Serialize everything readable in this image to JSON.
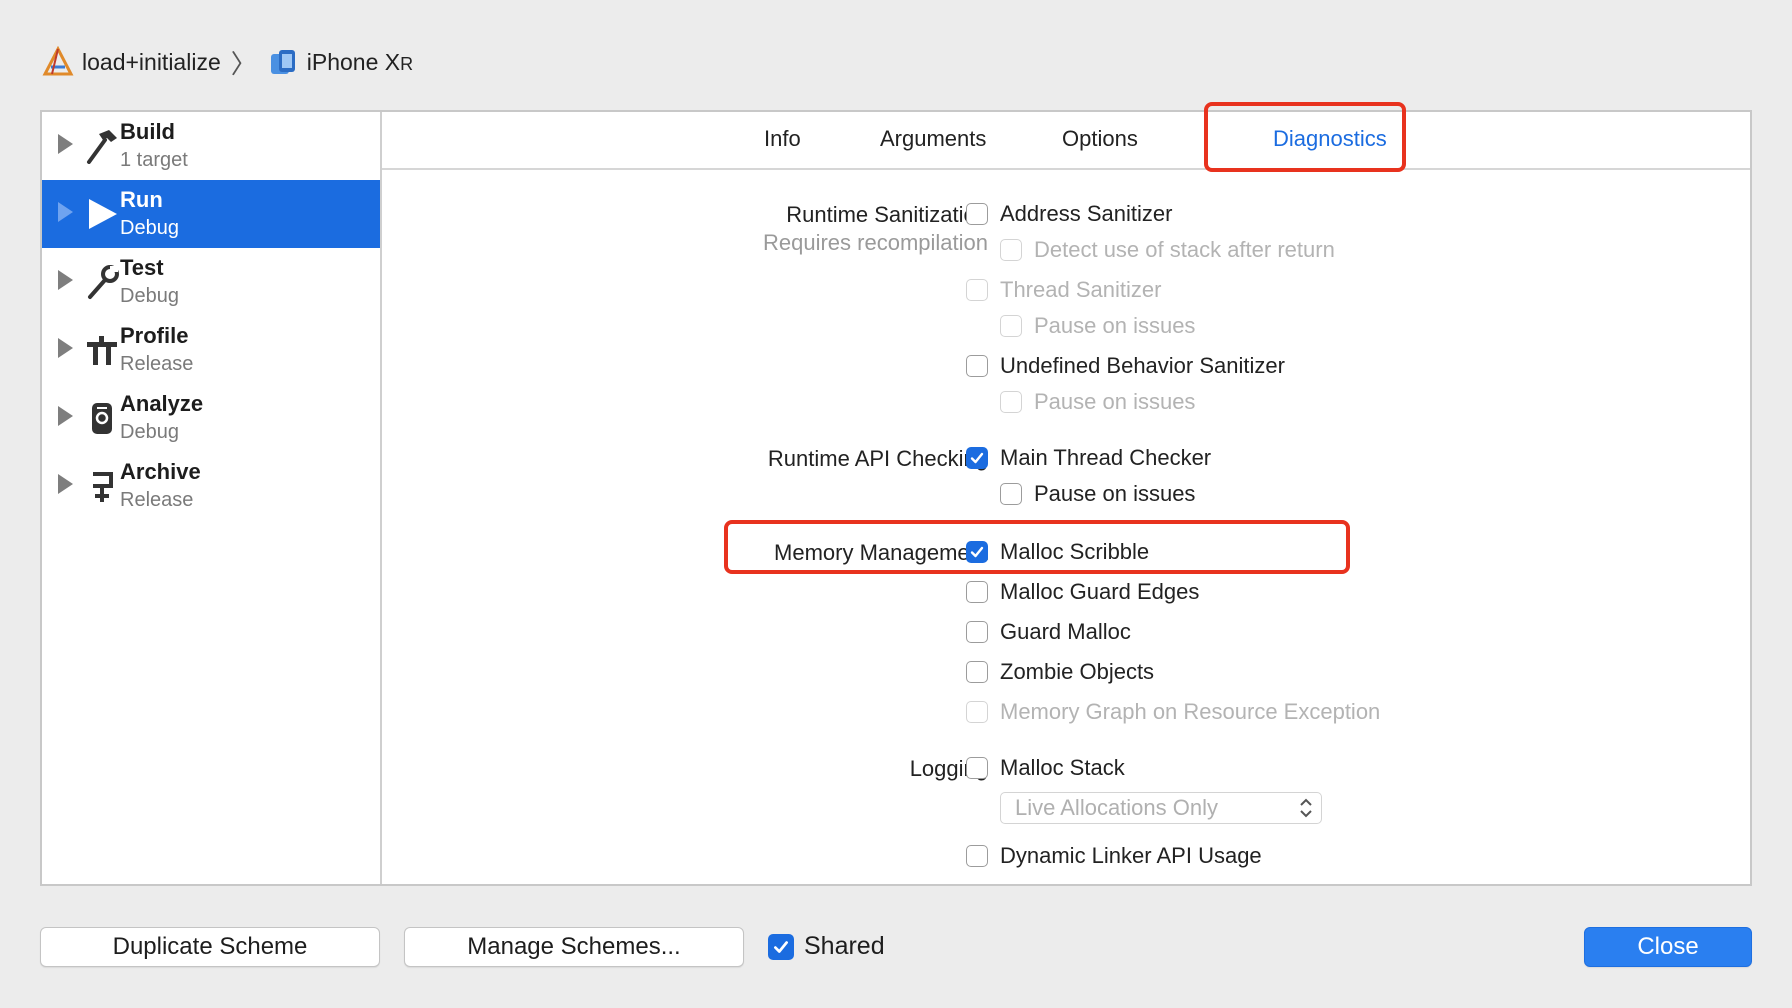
{
  "breadcrumb": {
    "project": "load+initialize",
    "device": "iPhone X",
    "device_suffix": "R"
  },
  "sidebar": {
    "actions": [
      {
        "title": "Build",
        "subtitle": "1 target",
        "icon": "hammer-icon"
      },
      {
        "title": "Run",
        "subtitle": "Debug",
        "icon": "play-icon",
        "selected": true
      },
      {
        "title": "Test",
        "subtitle": "Debug",
        "icon": "wrench-icon"
      },
      {
        "title": "Profile",
        "subtitle": "Release",
        "icon": "instruments-icon"
      },
      {
        "title": "Analyze",
        "subtitle": "Debug",
        "icon": "analyze-icon"
      },
      {
        "title": "Archive",
        "subtitle": "Release",
        "icon": "archive-icon"
      }
    ]
  },
  "tabs": {
    "info": "Info",
    "arguments": "Arguments",
    "options": "Options",
    "diagnostics": "Diagnostics",
    "active": "Diagnostics"
  },
  "sections": {
    "runtime_sanitization": "Runtime Sanitization",
    "requires_recompilation": "Requires recompilation",
    "runtime_api_checking": "Runtime API Checking",
    "memory_management": "Memory Management",
    "logging": "Logging"
  },
  "options": {
    "address_sanitizer": {
      "label": "Address Sanitizer",
      "checked": false,
      "enabled": true
    },
    "detect_stack_after_return": {
      "label": "Detect use of stack after return",
      "checked": false,
      "enabled": false
    },
    "thread_sanitizer": {
      "label": "Thread Sanitizer",
      "checked": false,
      "enabled": false
    },
    "thread_pause_on_issues": {
      "label": "Pause on issues",
      "checked": false,
      "enabled": false
    },
    "ub_sanitizer": {
      "label": "Undefined Behavior Sanitizer",
      "checked": false,
      "enabled": true
    },
    "ub_pause_on_issues": {
      "label": "Pause on issues",
      "checked": false,
      "enabled": false
    },
    "main_thread_checker": {
      "label": "Main Thread Checker",
      "checked": true,
      "enabled": true
    },
    "mtc_pause_on_issues": {
      "label": "Pause on issues",
      "checked": false,
      "enabled": true
    },
    "malloc_scribble": {
      "label": "Malloc Scribble",
      "checked": true,
      "enabled": true
    },
    "malloc_guard_edges": {
      "label": "Malloc Guard Edges",
      "checked": false,
      "enabled": true
    },
    "guard_malloc": {
      "label": "Guard Malloc",
      "checked": false,
      "enabled": true
    },
    "zombie_objects": {
      "label": "Zombie Objects",
      "checked": false,
      "enabled": true
    },
    "memory_graph": {
      "label": "Memory Graph on Resource Exception",
      "checked": false,
      "enabled": false
    },
    "malloc_stack": {
      "label": "Malloc Stack",
      "checked": false,
      "enabled": true
    },
    "malloc_stack_mode": {
      "value": "Live Allocations Only",
      "enabled": false
    },
    "dynamic_linker_api": {
      "label": "Dynamic Linker API Usage",
      "checked": false,
      "enabled": true
    }
  },
  "footer": {
    "duplicate_scheme": "Duplicate Scheme",
    "manage_schemes": "Manage Schemes...",
    "shared_label": "Shared",
    "shared_checked": true,
    "close": "Close"
  },
  "colors": {
    "accent": "#1b6ce0",
    "highlight": "#e8321e",
    "window_bg": "#ececec"
  }
}
